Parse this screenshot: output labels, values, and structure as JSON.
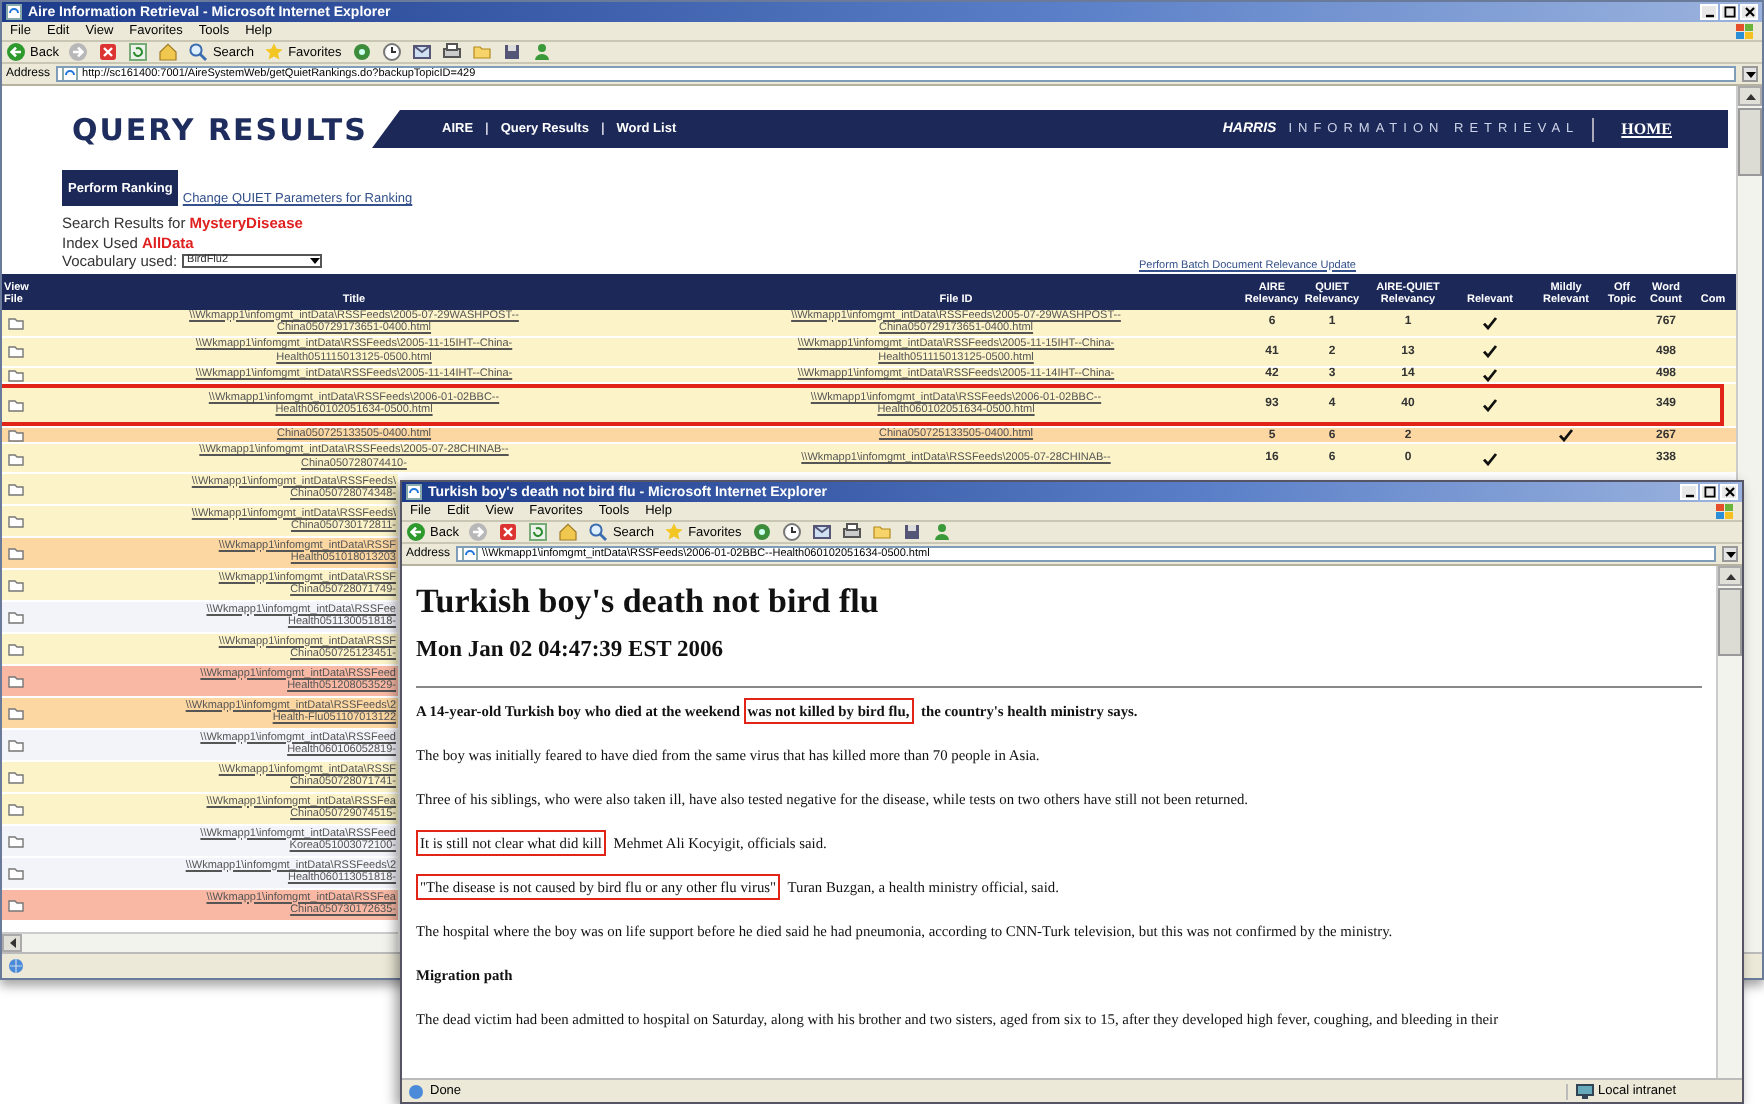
{
  "main_window": {
    "title": "Aire Information Retrieval - Microsoft Internet Explorer",
    "menu": [
      "File",
      "Edit",
      "View",
      "Favorites",
      "Tools",
      "Help"
    ],
    "toolbar": [
      {
        "kind": "back",
        "label": "Back"
      },
      {
        "kind": "forward"
      },
      {
        "kind": "stop"
      },
      {
        "kind": "refresh"
      },
      {
        "kind": "home"
      },
      {
        "kind": "search",
        "label": "Search"
      },
      {
        "kind": "favorites",
        "label": "Favorites"
      },
      {
        "kind": "media"
      },
      {
        "kind": "history"
      },
      {
        "kind": "mail"
      },
      {
        "kind": "print"
      },
      {
        "kind": "folder"
      },
      {
        "kind": "save"
      },
      {
        "kind": "messenger"
      }
    ],
    "address_label": "Address",
    "address": "http://sc161400:7001/AireSystemWeb/getQuietRankings.do?backupTopicID=429"
  },
  "header": {
    "title": "QUERY RESULTS",
    "nav": [
      "AIRE",
      "Query Results",
      "Word List"
    ],
    "nav_separator": "|",
    "brand_mark": "HARRIS",
    "brand_text": "INFORMATION RETRIEVAL",
    "home": "HOME"
  },
  "controls": {
    "rank_button": "Perform Ranking",
    "params_link": "Change QUIET Parameters for Ranking",
    "search_label": "Search Results for ",
    "search_term": "MysteryDisease",
    "index_label": "Index Used ",
    "index_value": "AllData",
    "vocab_label": "Vocabulary used:",
    "vocab_value": "BirdFlu2",
    "batch_link": "Perform Batch Document Relevance Update"
  },
  "table": {
    "columns": [
      "View File",
      "Title",
      "File ID",
      "AIRE Relevancy",
      "QUIET Relevancy",
      "AIRE-QUIET Relevancy",
      "Relevant",
      "Mildly Relevant",
      "Off Topic",
      "Word Count",
      "Com"
    ],
    "rows": [
      {
        "title": [
          "\\\\Wkmapp1\\infomgmt_intData\\RSSFeeds\\2005-07-29WASHPOST--",
          "China050729173651-0400.html"
        ],
        "file_id": [
          "\\\\Wkmapp1\\infomgmt_intData\\RSSFeeds\\2005-07-29WASHPOST--",
          "China050729173651-0400.html"
        ],
        "aire": "6",
        "quiet": "1",
        "aire_quiet": "1",
        "relevant": true,
        "mildly_relevant": false,
        "word_count": "767",
        "color": "#fcf4c8",
        "highlighted": false
      },
      {
        "title": [
          "\\\\Wkmapp1\\infomgmt_intData\\RSSFeeds\\2005-11-15IHT--China-",
          "Health051115013125-0500.html"
        ],
        "file_id": [
          "\\\\Wkmapp1\\infomgmt_intData\\RSSFeeds\\2005-11-15IHT--China-",
          "Health051115013125-0500.html"
        ],
        "aire": "41",
        "quiet": "2",
        "aire_quiet": "13",
        "relevant": true,
        "mildly_relevant": false,
        "word_count": "498",
        "color": "#fcf4c8",
        "highlighted": false
      },
      {
        "title": [
          "\\\\Wkmapp1\\infomgmt_intData\\RSSFeeds\\2005-11-14IHT--China-"
        ],
        "file_id": [
          "\\\\Wkmapp1\\infomgmt_intData\\RSSFeeds\\2005-11-14IHT--China-"
        ],
        "aire": "42",
        "quiet": "3",
        "aire_quiet": "14",
        "relevant": true,
        "mildly_relevant": false,
        "word_count": "498",
        "color": "#fcf4c8",
        "highlighted": false
      },
      {
        "title": [
          "\\\\Wkmapp1\\infomgmt_intData\\RSSFeeds\\2006-01-02BBC--",
          "Health060102051634-0500.html"
        ],
        "file_id": [
          "\\\\Wkmapp1\\infomgmt_intData\\RSSFeeds\\2006-01-02BBC--",
          "Health060102051634-0500.html"
        ],
        "aire": "93",
        "quiet": "4",
        "aire_quiet": "40",
        "relevant": true,
        "mildly_relevant": false,
        "word_count": "349",
        "color": "#fcf4c8",
        "highlighted": true
      },
      {
        "title": [
          "China050725133505-0400.html"
        ],
        "file_id": [
          "China050725133505-0400.html"
        ],
        "aire": "5",
        "quiet": "6",
        "aire_quiet": "2",
        "relevant": false,
        "mildly_relevant": true,
        "word_count": "267",
        "color": "#fcd7a2",
        "highlighted": false
      },
      {
        "title": [
          "\\\\Wkmapp1\\infomgmt_intData\\RSSFeeds\\2005-07-28CHINAB--",
          "China050728074410-"
        ],
        "file_id": [
          "\\\\Wkmapp1\\infomgmt_intData\\RSSFeeds\\2005-07-28CHINAB--"
        ],
        "aire": "16",
        "quiet": "6",
        "aire_quiet": "0",
        "relevant": true,
        "mildly_relevant": false,
        "word_count": "338",
        "color": "#fcf4c8",
        "highlighted": false
      }
    ],
    "covered_rows": [
      {
        "title": [
          "\\\\Wkmapp1\\infomgmt_intData\\RSSFeeds\\",
          "China050728074348-"
        ],
        "color": "#fcf4c8"
      },
      {
        "title": [
          "\\\\Wkmapp1\\infomgmt_intData\\RSSFeeds\\",
          "China050730172811-"
        ],
        "color": "#fcf4c8"
      },
      {
        "title": [
          "\\\\Wkmapp1\\infomgmt_intData\\RSSF",
          "Health051018013203"
        ],
        "color": "#fcd7a2"
      },
      {
        "title": [
          "\\\\Wkmapp1\\infomgmt_intData\\RSSF",
          "China050728071749-"
        ],
        "color": "#fcf4c8"
      },
      {
        "title": [
          "\\\\Wkmapp1\\infomgmt_intData\\RSSFee",
          "Health051130051818-"
        ],
        "color": "#f3f3fa"
      },
      {
        "title": [
          "\\\\Wkmapp1\\infomgmt_intData\\RSSF",
          "China050725123451-"
        ],
        "color": "#fcf4c8"
      },
      {
        "title": [
          "\\\\Wkmapp1\\infomgmt_intData\\RSSFeed",
          "Health051208053529-"
        ],
        "color": "#f8b8a4"
      },
      {
        "title": [
          "\\\\Wkmapp1\\infomgmt_intData\\RSSFeeds\\2",
          "Health-Flu051107013122"
        ],
        "color": "#fcd7a2"
      },
      {
        "title": [
          "\\\\Wkmapp1\\infomgmt_intData\\RSSFeed",
          "Health060106052819-"
        ],
        "color": "#f3f3fa"
      },
      {
        "title": [
          "\\\\Wkmapp1\\infomgmt_intData\\RSSF",
          "China050728071741-"
        ],
        "color": "#fcf4c8"
      },
      {
        "title": [
          "\\\\Wkmapp1\\infomgmt_intData\\RSSFea",
          "China050729074515-"
        ],
        "color": "#fcf4c8"
      },
      {
        "title": [
          "\\\\Wkmapp1\\infomgmt_intData\\RSSFeed",
          "Korea051003072100-"
        ],
        "color": "#f3f3fa"
      },
      {
        "title": [
          "\\\\Wkmapp1\\infomgmt_intData\\RSSFeeds\\2",
          "Health060113051818-"
        ],
        "color": "#f3f3fa"
      },
      {
        "title": [
          "\\\\Wkmapp1\\infomgmt_intData\\RSSFea",
          "China050730172635-"
        ],
        "color": "#f8b8a4"
      }
    ]
  },
  "popup_window": {
    "title": "Turkish boy's death not bird flu - Microsoft Internet Explorer",
    "menu": [
      "File",
      "Edit",
      "View",
      "Favorites",
      "Tools",
      "Help"
    ],
    "toolbar": [
      {
        "kind": "back",
        "label": "Back"
      },
      {
        "kind": "forward"
      },
      {
        "kind": "stop"
      },
      {
        "kind": "refresh"
      },
      {
        "kind": "home"
      },
      {
        "kind": "search",
        "label": "Search"
      },
      {
        "kind": "favorites",
        "label": "Favorites"
      },
      {
        "kind": "media"
      },
      {
        "kind": "history"
      },
      {
        "kind": "mail"
      },
      {
        "kind": "print"
      },
      {
        "kind": "folder"
      },
      {
        "kind": "save"
      },
      {
        "kind": "messenger"
      }
    ],
    "address_label": "Address",
    "address": "\\\\Wkmapp1\\infomgmt_intData\\RSSFeeds\\2006-01-02BBC--Health060102051634-0500.html"
  },
  "article": {
    "headline": "Turkish boy's death not bird flu",
    "date": "Mon Jan 02 04:47:39 EST 2006",
    "paragraphs": [
      {
        "kind": "lead",
        "segments": [
          {
            "text": "A 14-year-old Turkish boy who died at the weekend ",
            "boxed": false
          },
          {
            "text": "was not killed by bird flu,",
            "boxed": true
          },
          {
            "text": " the country's health ministry says.",
            "boxed": false
          }
        ]
      },
      {
        "kind": "body",
        "segments": [
          {
            "text": "The boy was initially feared to have died from the same virus that has killed more than 70 people in Asia.",
            "boxed": false
          }
        ]
      },
      {
        "kind": "body",
        "segments": [
          {
            "text": "Three of his siblings, who were also taken ill, have also tested negative for the disease, while tests on two others have still not been returned.",
            "boxed": false
          }
        ]
      },
      {
        "kind": "body",
        "segments": [
          {
            "text": "It is still not clear what did kill",
            "boxed": true
          },
          {
            "text": " Mehmet Ali Kocyigit, officials said.",
            "boxed": false
          }
        ]
      },
      {
        "kind": "body",
        "segments": [
          {
            "text": "\"The disease is not caused by bird flu or any other flu virus\"",
            "boxed": true
          },
          {
            "text": " Turan Buzgan, a health ministry official, said.",
            "boxed": false
          }
        ]
      },
      {
        "kind": "body",
        "segments": [
          {
            "text": "The hospital where the boy was on life support before he died said he had pneumonia, according to CNN-Turk television, but this was not confirmed by the ministry.",
            "boxed": false
          }
        ]
      },
      {
        "kind": "heading",
        "segments": [
          {
            "text": "Migration path",
            "boxed": false
          }
        ]
      },
      {
        "kind": "body",
        "segments": [
          {
            "text": "The dead victim had been admitted to hospital on Saturday, along with his brother and two sisters, aged from six to 15, after they developed high fever, coughing, and bleeding in their",
            "boxed": false
          }
        ]
      }
    ]
  },
  "popup_status": {
    "text": "Done",
    "zone": "Local intranet"
  }
}
